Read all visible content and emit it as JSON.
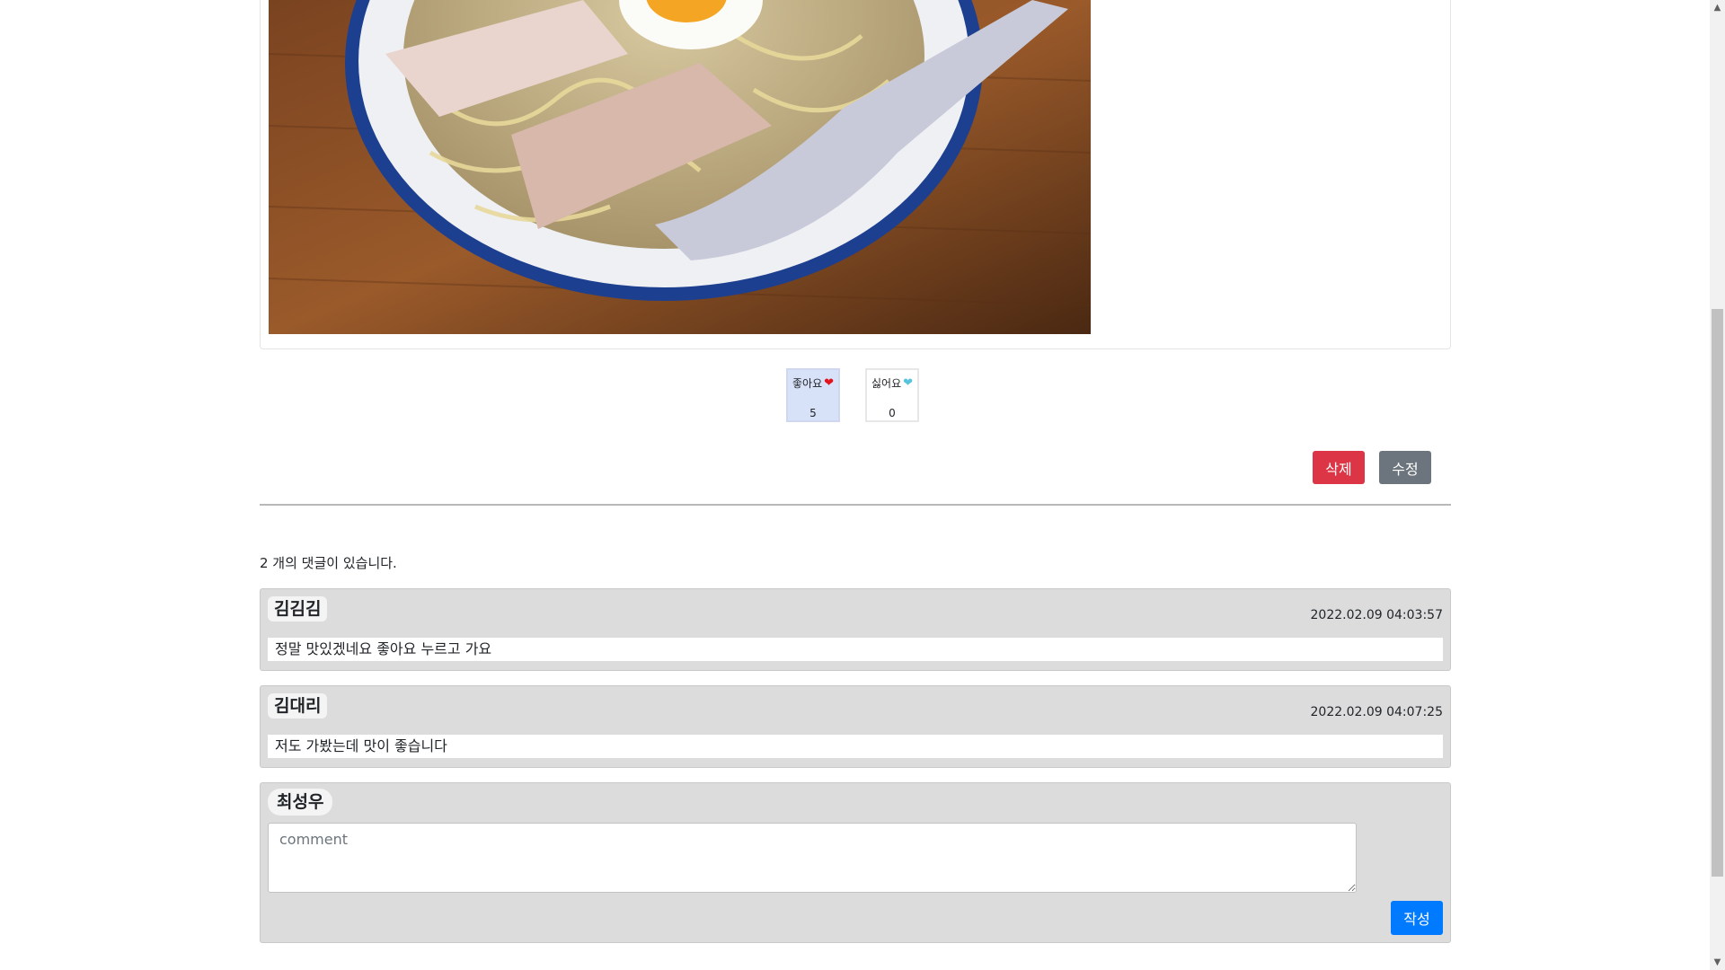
{
  "post": {
    "image_alt": "ramen bowl photo"
  },
  "reactions": {
    "like": {
      "label": "좋아요",
      "count": "5",
      "icon": "heart-icon"
    },
    "dislike": {
      "label": "싫어요",
      "count": "0",
      "icon": "broken-heart-icon"
    }
  },
  "actions": {
    "delete_label": "삭제",
    "edit_label": "수정"
  },
  "comments": {
    "count_text": "2 개의 댓글이 있습니다.",
    "items": [
      {
        "author": "김김김",
        "date": "2022.02.09 04:03:57",
        "text": "정말 맛있겠네요 좋아요 누르고 가요"
      },
      {
        "author": "김대리",
        "date": "2022.02.09 04:07:25",
        "text": "저도 가봤는데 맛이 좋습니다"
      }
    ]
  },
  "comment_form": {
    "author": "최성우",
    "placeholder": "comment",
    "submit_label": "작성"
  },
  "colors": {
    "delete": "#dc3545",
    "edit": "#6c757d",
    "submit": "#007bff",
    "like_active": "#d7e1f7"
  }
}
